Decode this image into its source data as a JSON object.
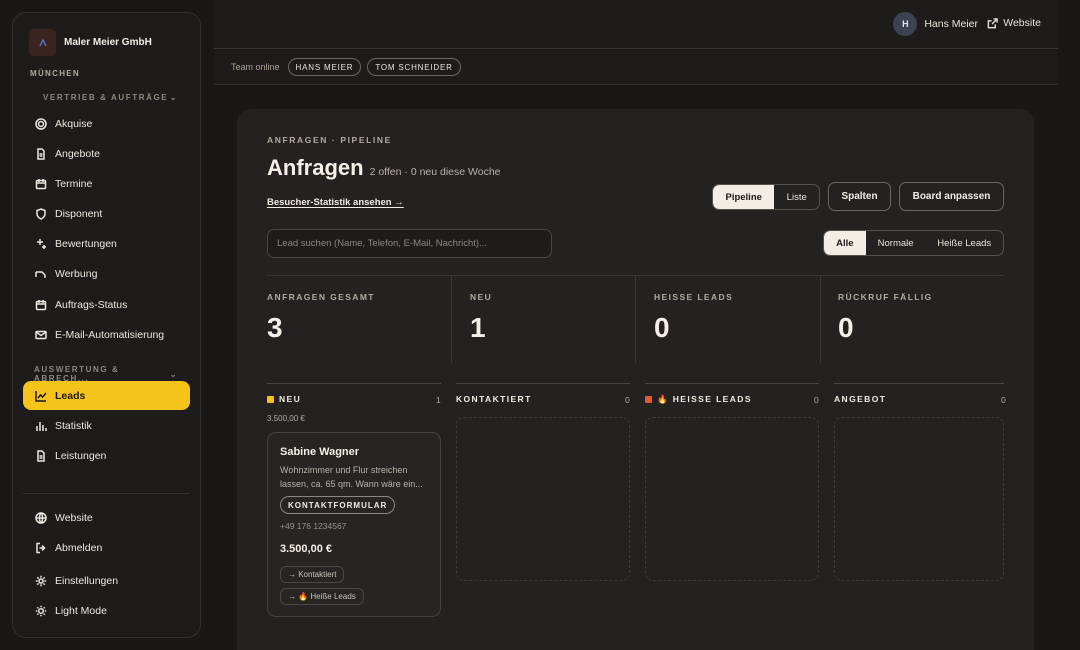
{
  "sidebar": {
    "company": "Maler Meier GmbH",
    "location": "MÜNCHEN",
    "group1": "VERTRIEB & AUFTRÄGE",
    "items1": [
      {
        "label": "Akquise"
      },
      {
        "label": "Angebote"
      },
      {
        "label": "Termine"
      },
      {
        "label": "Disponent"
      },
      {
        "label": "Bewertungen"
      },
      {
        "label": "Werbung"
      },
      {
        "label": "Auftrags-Status"
      },
      {
        "label": "E-Mail-Automatisierung"
      }
    ],
    "group2": "AUSWERTUNG & ABRECH...",
    "items2": [
      {
        "label": "Leads"
      },
      {
        "label": "Statistik"
      },
      {
        "label": "Leistungen"
      }
    ],
    "bottom": [
      {
        "label": "Website"
      },
      {
        "label": "Abmelden"
      },
      {
        "label": "Einstellungen"
      },
      {
        "label": "Light Mode"
      }
    ]
  },
  "topbar": {
    "avatar_initial": "H",
    "user_name": "Hans Meier",
    "website_label": "Website"
  },
  "team": {
    "label": "Team online",
    "members": [
      "HANS MEIER",
      "TOM SCHNEIDER"
    ]
  },
  "main": {
    "eyebrow": "ANFRAGEN · PIPELINE",
    "title": "Anfragen",
    "subtitle": "2 offen · 0 neu diese Woche",
    "visitor_link": "Besucher-Statistik ansehen →",
    "view_toggle": [
      "Pipeline",
      "Liste"
    ],
    "columns_btn": "Spalten",
    "board_btn": "Board anpassen",
    "search_placeholder": "Lead suchen (Name, Telefon, E-Mail, Nachricht)...",
    "filter": [
      "Alle",
      "Normale",
      "Heiße Leads"
    ],
    "stats": [
      {
        "label": "ANFRAGEN GESAMT",
        "value": "3"
      },
      {
        "label": "NEU",
        "value": "1"
      },
      {
        "label": "HEISSE LEADS",
        "value": "0"
      },
      {
        "label": "RÜCKRUF FÄLLIG",
        "value": "0"
      }
    ],
    "columns": [
      {
        "title": "NEU",
        "count": "1",
        "sum": "3.500,00 €",
        "color": "#f5c41a"
      },
      {
        "title": "KONTAKTIERT",
        "count": "0"
      },
      {
        "title": "🔥 HEISSE LEADS",
        "count": "0",
        "color": "#e05a32"
      },
      {
        "title": "ANGEBOT",
        "count": "0"
      }
    ],
    "lead": {
      "name": "Sabine Wagner",
      "description": "Wohnzimmer und Flur streichen lassen, ca. 65 qm. Wann wäre ein...",
      "tag": "KONTAKTFORMULAR",
      "phone": "+49 176 1234567",
      "amount": "3.500,00 €",
      "action1": "→ Kontaktiert",
      "action2": "→ 🔥 Heiße Leads"
    }
  },
  "colors": {
    "accent": "#f5c41a",
    "hot": "#e05a32",
    "background": "#1a1816",
    "card": "#242220"
  }
}
